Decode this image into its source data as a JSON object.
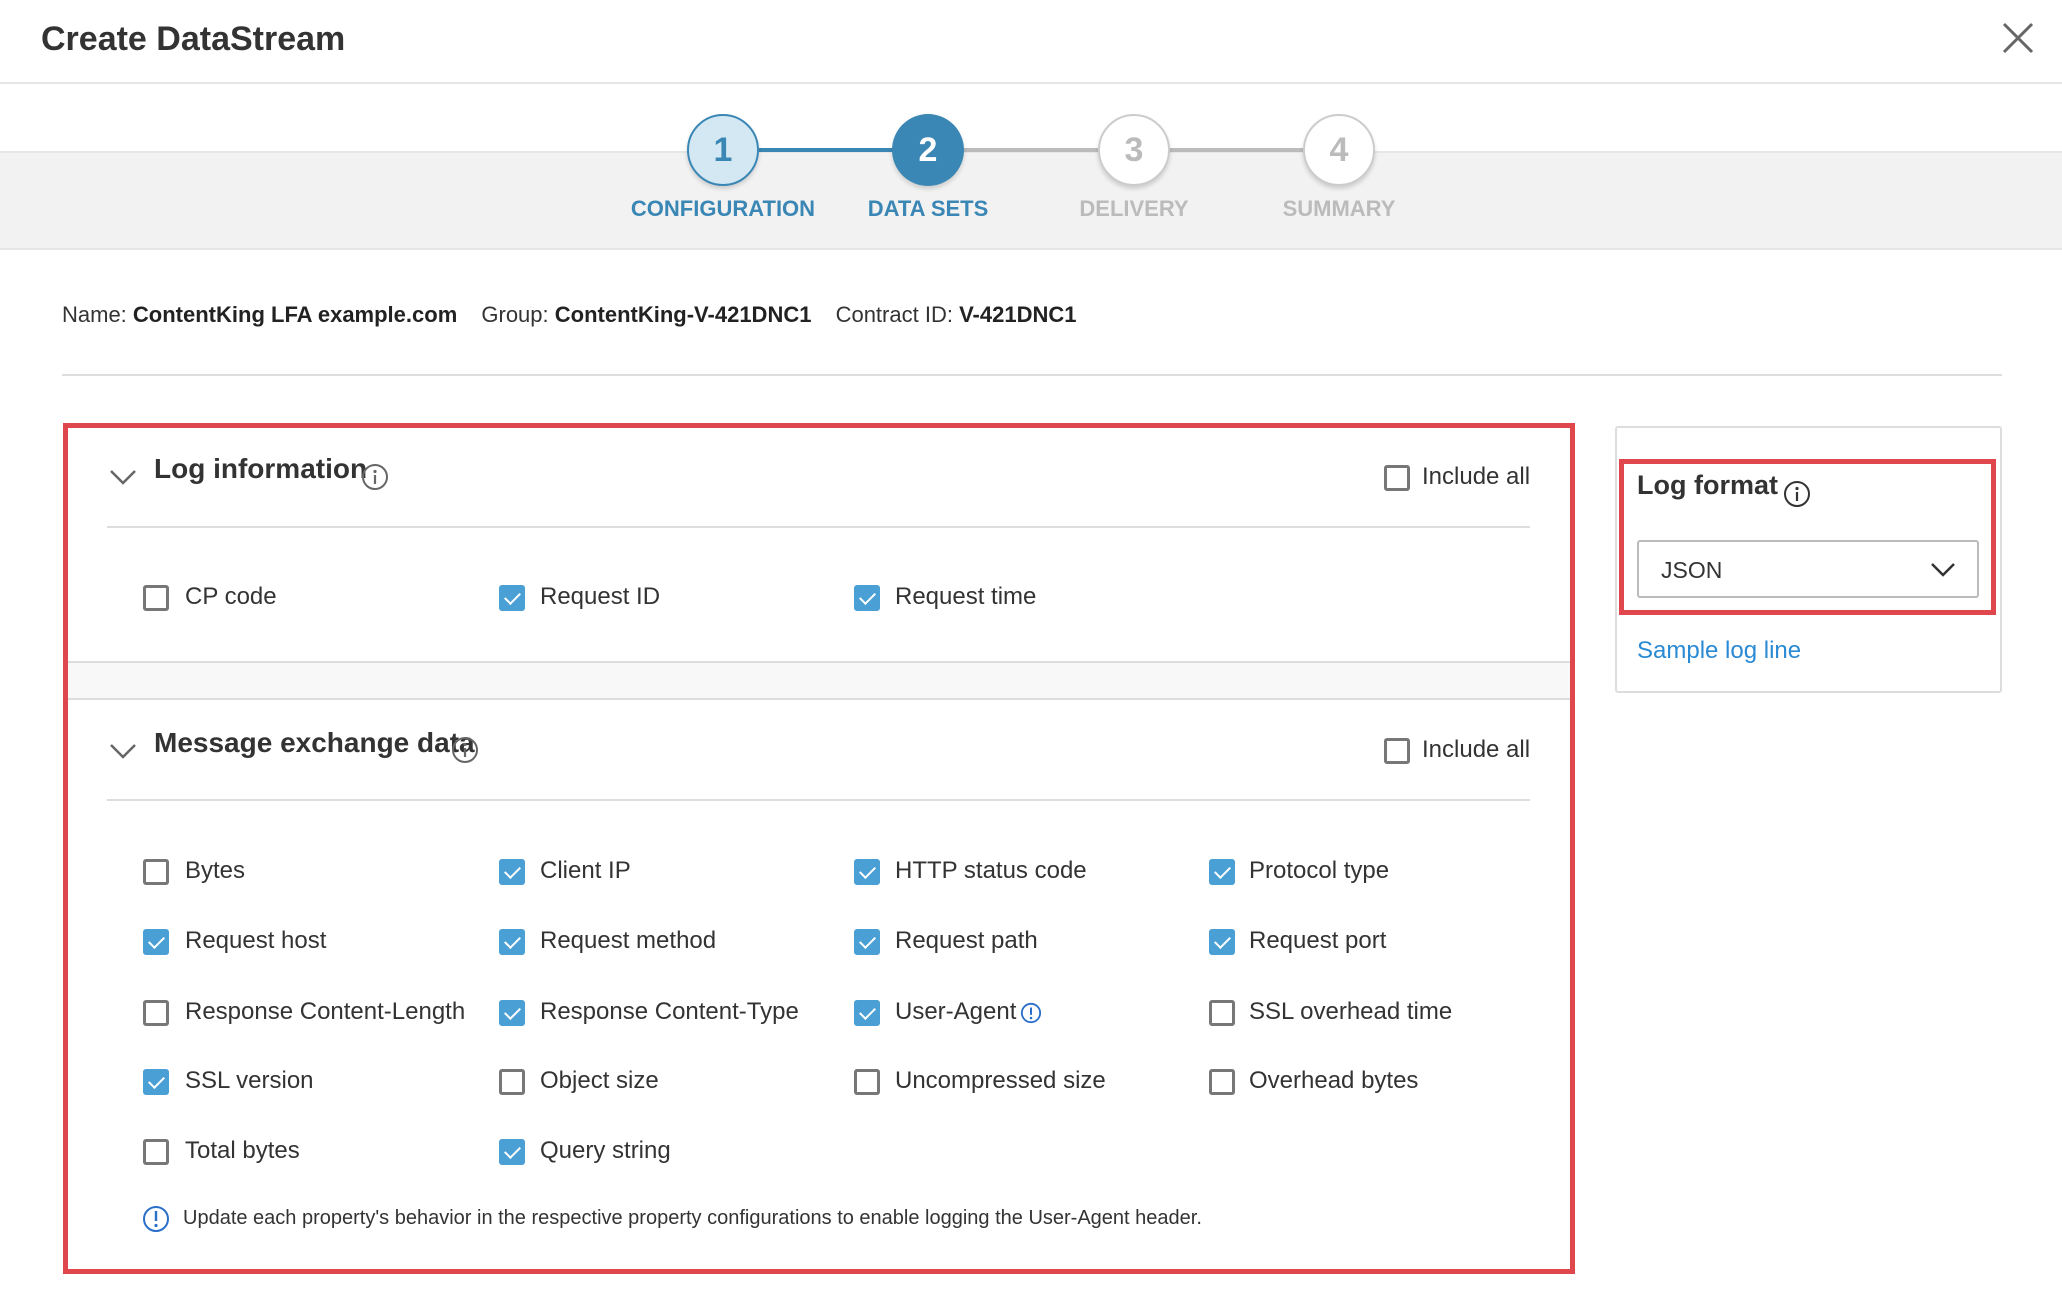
{
  "header": {
    "title": "Create DataStream",
    "close_icon": "close-icon"
  },
  "steps": [
    {
      "number": "1",
      "label": "CONFIGURATION",
      "state": "completed"
    },
    {
      "number": "2",
      "label": "DATA SETS",
      "state": "active"
    },
    {
      "number": "3",
      "label": "DELIVERY",
      "state": "pending"
    },
    {
      "number": "4",
      "label": "SUMMARY",
      "state": "pending"
    }
  ],
  "meta": {
    "name_label": "Name:",
    "name": "ContentKing LFA example.com",
    "group_label": "Group:",
    "group": "ContentKing-V-421DNC1",
    "contract_label": "Contract ID:",
    "contract": "V-421DNC1"
  },
  "log_information": {
    "title": "Log information",
    "include_all": "Include all",
    "include_all_checked": false,
    "items": [
      {
        "label": "CP code",
        "checked": false
      },
      {
        "label": "Request ID",
        "checked": true
      },
      {
        "label": "Request time",
        "checked": true
      }
    ]
  },
  "message_exchange": {
    "title": "Message exchange data",
    "include_all": "Include all",
    "include_all_checked": false,
    "items": [
      {
        "label": "Bytes",
        "checked": false
      },
      {
        "label": "Client IP",
        "checked": true
      },
      {
        "label": "HTTP status code",
        "checked": true
      },
      {
        "label": "Protocol type",
        "checked": true
      },
      {
        "label": "Request host",
        "checked": true
      },
      {
        "label": "Request method",
        "checked": true
      },
      {
        "label": "Request path",
        "checked": true
      },
      {
        "label": "Request port",
        "checked": true
      },
      {
        "label": "Response Content-Length",
        "checked": false
      },
      {
        "label": "Response Content-Type",
        "checked": true
      },
      {
        "label": "User-Agent",
        "checked": true,
        "warning": true
      },
      {
        "label": "SSL overhead time",
        "checked": false
      },
      {
        "label": "SSL version",
        "checked": true
      },
      {
        "label": "Object size",
        "checked": false
      },
      {
        "label": "Uncompressed size",
        "checked": false
      },
      {
        "label": "Overhead bytes",
        "checked": false
      },
      {
        "label": "Total bytes",
        "checked": false
      },
      {
        "label": "Query string",
        "checked": true
      }
    ],
    "note": "Update each property's behavior in the respective property configurations to enable logging the User-Agent header."
  },
  "log_format": {
    "title": "Log format",
    "value": "JSON",
    "sample_link": "Sample log line"
  },
  "colors": {
    "accent": "#3a87b5",
    "checkbox": "#4a9fd5",
    "highlight": "#e0474c",
    "link": "#2a8ad4"
  }
}
